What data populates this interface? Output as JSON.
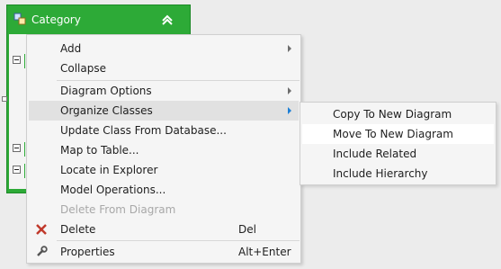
{
  "entity": {
    "title": "Category",
    "icon": "entity-icon",
    "collapse_icon": "chevron-double-up-icon",
    "header_color": "#2daa37"
  },
  "context_menu": {
    "items": [
      {
        "label": "Add",
        "submenu": true
      },
      {
        "label": "Collapse"
      },
      {
        "label": "Diagram Options",
        "submenu": true
      },
      {
        "label": "Organize Classes",
        "submenu": true,
        "highlighted": true
      },
      {
        "label": "Update Class From Database..."
      },
      {
        "label": "Map to Table..."
      },
      {
        "label": "Locate in Explorer"
      },
      {
        "label": "Model Operations..."
      },
      {
        "label": "Delete From Diagram",
        "disabled": true
      },
      {
        "label": "Delete",
        "shortcut": "Del",
        "icon": "delete-x-icon"
      },
      {
        "label": "Properties",
        "shortcut": "Alt+Enter",
        "icon": "wrench-icon"
      }
    ]
  },
  "submenu": {
    "items": [
      {
        "label": "Copy To New Diagram"
      },
      {
        "label": "Move To New Diagram",
        "highlighted": true
      },
      {
        "label": "Include Related"
      },
      {
        "label": "Include Hierarchy"
      }
    ]
  },
  "colors": {
    "accent_arrow": "#1e7fd6",
    "delete_icon": "#c0392b",
    "menu_background": "#f5f5f5",
    "highlight": "#e1e1e1"
  }
}
